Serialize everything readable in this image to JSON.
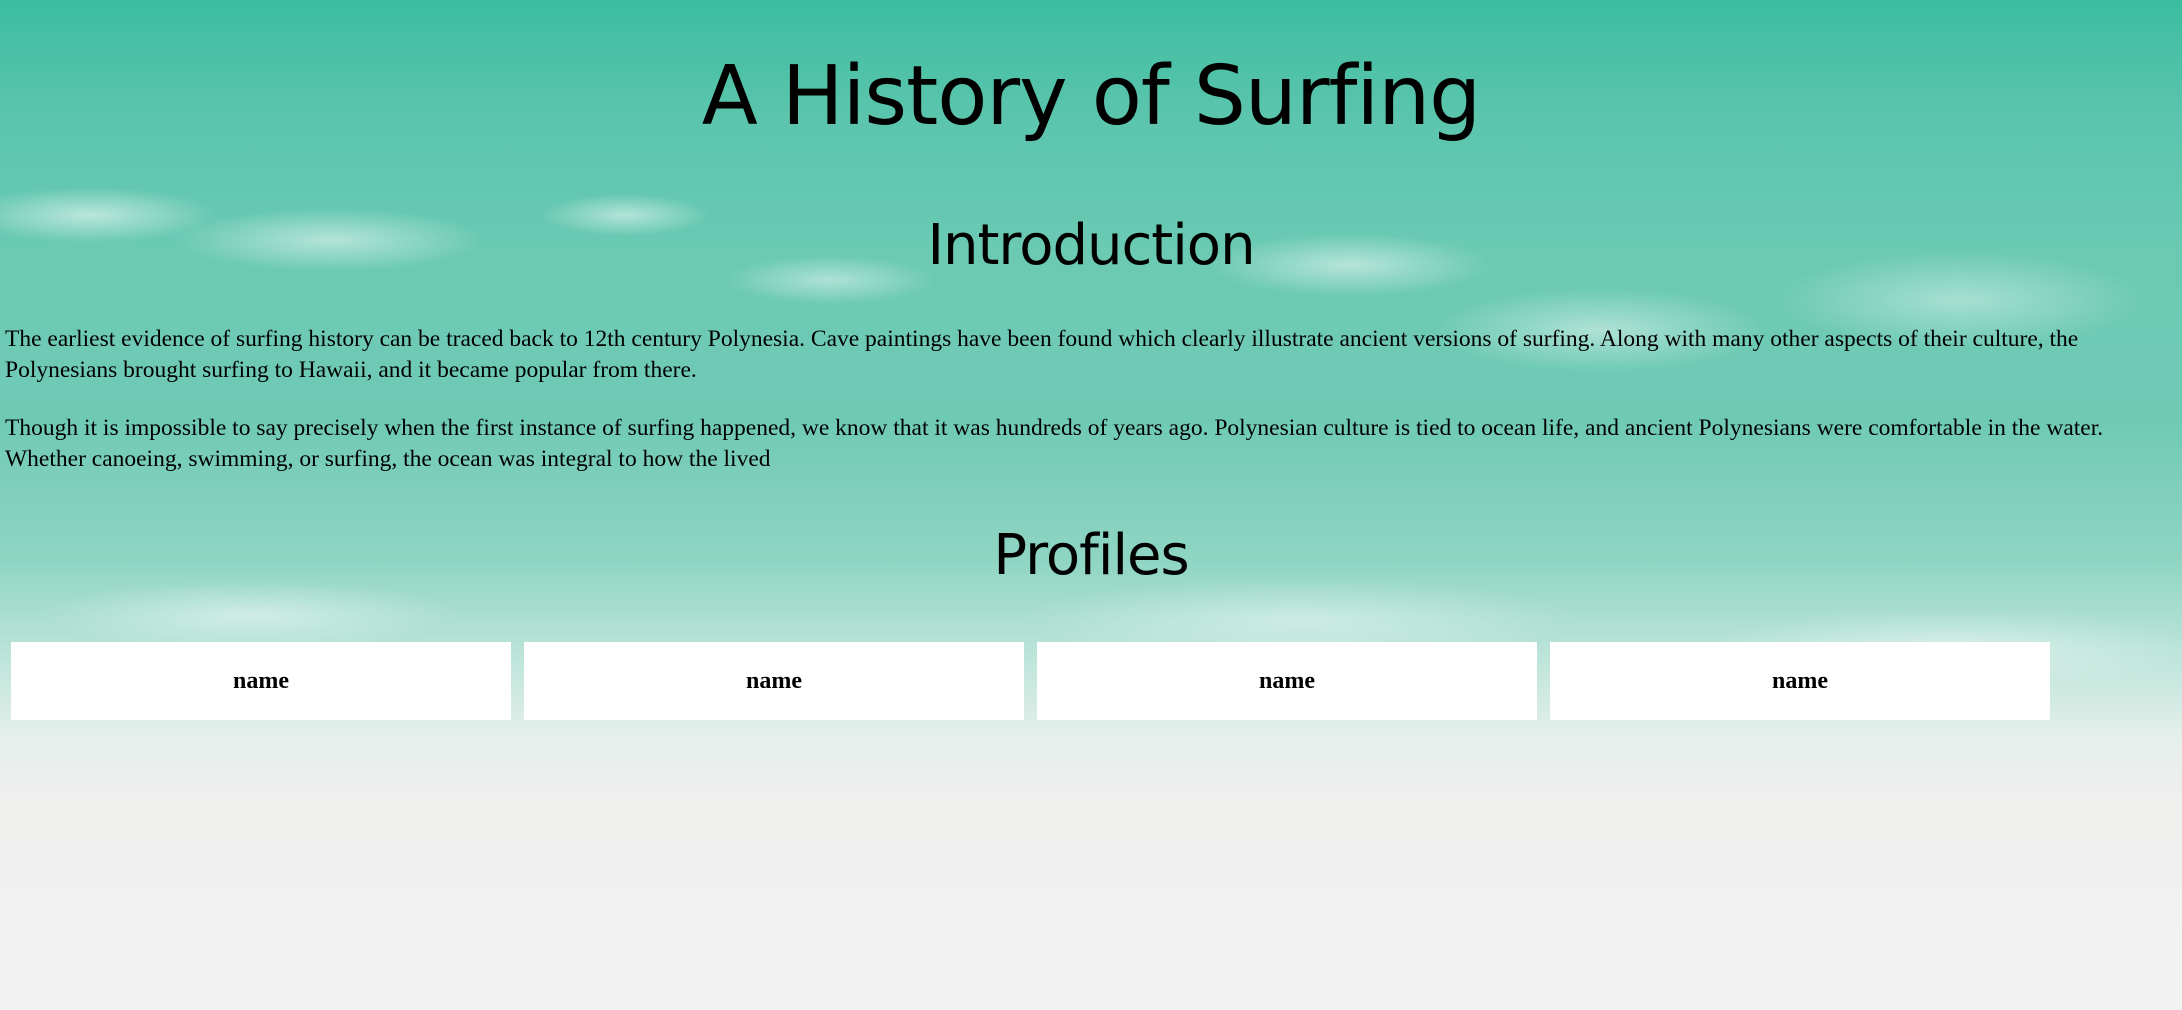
{
  "page": {
    "title": "A History of Surfing"
  },
  "introduction": {
    "heading": "Introduction",
    "paragraphs": [
      "The earliest evidence of surfing history can be traced back to 12th century Polynesia. Cave paintings have been found which clearly illustrate ancient versions of surfing. Along with many other aspects of their culture, the Polynesians brought surfing to Hawaii, and it became popular from there.",
      "Though it is impossible to say precisely when the first instance of surfing happened, we know that it was hundreds of years ago. Polynesian culture is tied to ocean life, and ancient Polynesians were comfortable in the water. Whether canoeing, swimming, or surfing, the ocean was integral to how the lived"
    ]
  },
  "profiles": {
    "heading": "Profiles",
    "cards": [
      {
        "name": "name"
      },
      {
        "name": "name"
      },
      {
        "name": "name"
      },
      {
        "name": "name"
      }
    ]
  },
  "colors": {
    "ocean": "#5cc5ad",
    "sand": "#f2f2f2",
    "card_background": "#ffffff",
    "text": "#000000"
  }
}
